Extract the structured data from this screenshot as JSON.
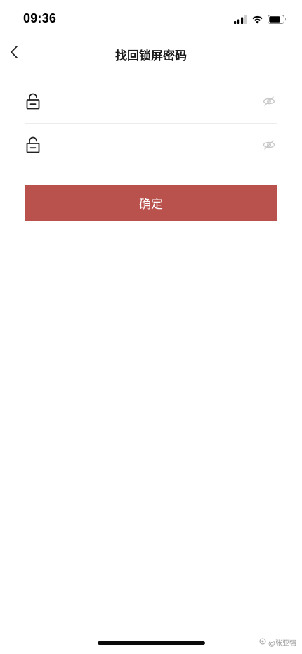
{
  "status_bar": {
    "time": "09:36",
    "icons": [
      "cellular-signal-icon",
      "wifi-icon",
      "battery-icon"
    ]
  },
  "nav": {
    "back_icon": "chevron-left-icon",
    "title": "找回锁屏密码"
  },
  "form": {
    "fields": [
      {
        "icon": "lock-icon",
        "value": "",
        "placeholder": "",
        "toggle_icon": "eye-hidden-icon"
      },
      {
        "icon": "lock-icon",
        "value": "",
        "placeholder": "",
        "toggle_icon": "eye-hidden-icon"
      }
    ],
    "confirm_label": "确定"
  },
  "watermark": {
    "text": "@张亚强"
  },
  "colors": {
    "primary_button": "#b9524d",
    "divider": "#ececec",
    "icon_muted": "#c8c8c8",
    "text_dark": "#1a1a1a"
  }
}
